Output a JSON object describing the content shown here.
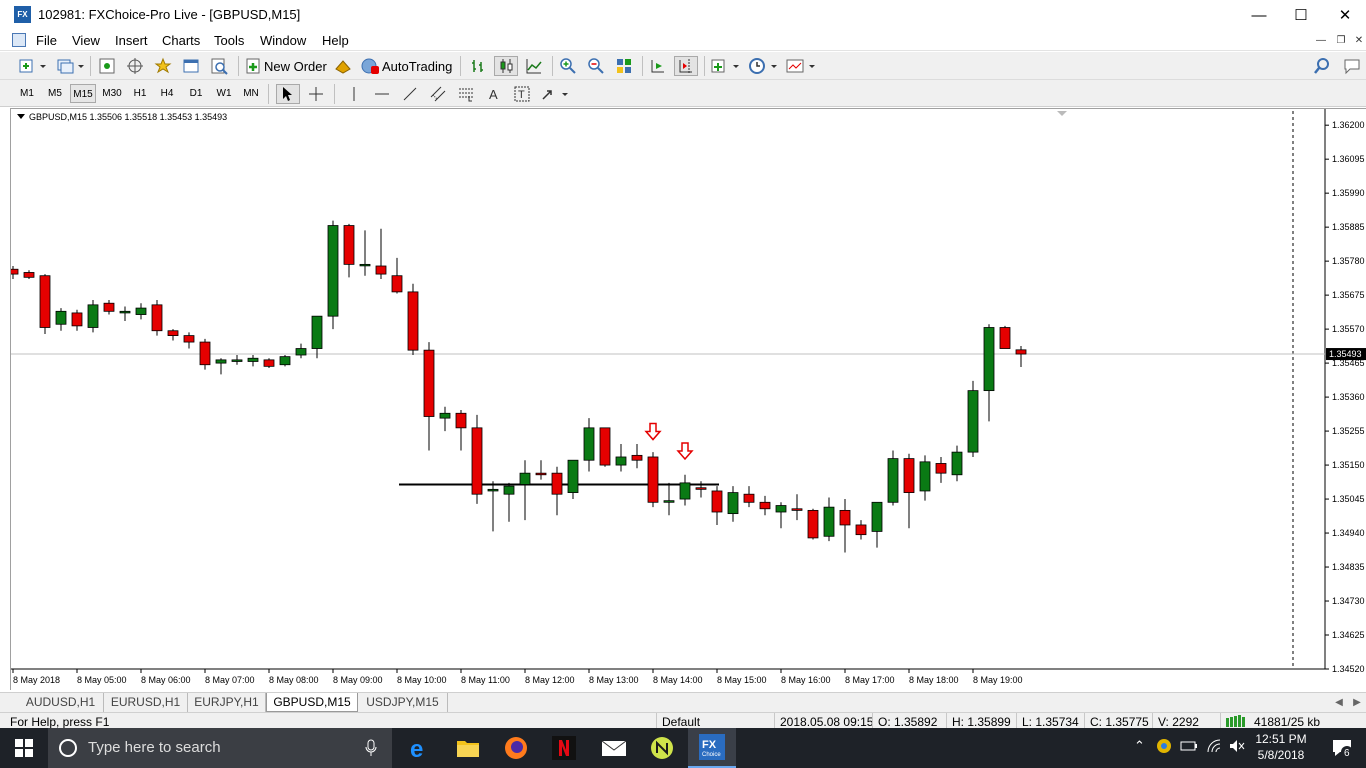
{
  "window": {
    "title": "102981: FXChoice-Pro Live - [GBPUSD,M15]",
    "app_icon_text": "FX"
  },
  "menu": [
    "File",
    "View",
    "Insert",
    "Charts",
    "Tools",
    "Window",
    "Help"
  ],
  "toolbar": {
    "new_order": "New Order",
    "autotrading": "AutoTrading"
  },
  "timeframes": [
    "M1",
    "M5",
    "M15",
    "M30",
    "H1",
    "H4",
    "D1",
    "W1",
    "MN"
  ],
  "active_timeframe": "M15",
  "chart_header": "GBPUSD,M15  1.35506 1.35518 1.35453 1.35493",
  "current_price_label": "1.35493",
  "chart_data": {
    "type": "candlestick",
    "symbol": "GBPUSD",
    "timeframe": "M15",
    "ylim": [
      1.3452,
      1.3625
    ],
    "y_ticks": [
      "1.36200",
      "1.36095",
      "1.35990",
      "1.35885",
      "1.35780",
      "1.35675",
      "1.35570",
      "1.35465",
      "1.35360",
      "1.35255",
      "1.35150",
      "1.35045",
      "1.34940",
      "1.34835",
      "1.34730",
      "1.34625",
      "1.34520"
    ],
    "x_ticks": [
      "8 May 2018",
      "8 May 05:00",
      "8 May 06:00",
      "8 May 07:00",
      "8 May 08:00",
      "8 May 09:00",
      "8 May 10:00",
      "8 May 11:00",
      "8 May 12:00",
      "8 May 13:00",
      "8 May 14:00",
      "8 May 15:00",
      "8 May 16:00",
      "8 May 17:00",
      "8 May 18:00",
      "8 May 19:00"
    ],
    "candles": [
      [
        1.35755,
        1.35765,
        1.35725,
        1.3574
      ],
      [
        1.35745,
        1.35752,
        1.35725,
        1.3573
      ],
      [
        1.35735,
        1.3574,
        1.35555,
        1.35575
      ],
      [
        1.35585,
        1.35635,
        1.35565,
        1.35625
      ],
      [
        1.3562,
        1.3563,
        1.35565,
        1.3558
      ],
      [
        1.35575,
        1.3566,
        1.3556,
        1.35645
      ],
      [
        1.3565,
        1.3566,
        1.35615,
        1.35625
      ],
      [
        1.3562,
        1.3564,
        1.35595,
        1.35625
      ],
      [
        1.35615,
        1.3565,
        1.356,
        1.35635
      ],
      [
        1.35645,
        1.3566,
        1.3555,
        1.35565
      ],
      [
        1.35565,
        1.3557,
        1.35535,
        1.3555
      ],
      [
        1.3555,
        1.3556,
        1.3551,
        1.3553
      ],
      [
        1.3553,
        1.3554,
        1.35445,
        1.3546
      ],
      [
        1.35465,
        1.3548,
        1.3543,
        1.35475
      ],
      [
        1.3547,
        1.3549,
        1.3546,
        1.35475
      ],
      [
        1.3547,
        1.3549,
        1.35455,
        1.3548
      ],
      [
        1.35475,
        1.3548,
        1.3545,
        1.35455
      ],
      [
        1.3546,
        1.3549,
        1.35455,
        1.35485
      ],
      [
        1.3549,
        1.35525,
        1.3548,
        1.3551
      ],
      [
        1.3551,
        1.35575,
        1.3548,
        1.3561
      ],
      [
        1.3561,
        1.35905,
        1.3557,
        1.3589
      ],
      [
        1.3589,
        1.35895,
        1.3573,
        1.3577
      ],
      [
        1.3577,
        1.35875,
        1.35735,
        1.3577
      ],
      [
        1.35765,
        1.3588,
        1.35725,
        1.3574
      ],
      [
        1.35735,
        1.3579,
        1.3568,
        1.35685
      ],
      [
        1.35685,
        1.3571,
        1.3549,
        1.35505
      ],
      [
        1.35505,
        1.3553,
        1.35195,
        1.353
      ],
      [
        1.35295,
        1.3533,
        1.35255,
        1.3531
      ],
      [
        1.3531,
        1.3532,
        1.35195,
        1.35265
      ],
      [
        1.35265,
        1.35305,
        1.3503,
        1.3506
      ],
      [
        1.3507,
        1.351,
        1.34945,
        1.35075
      ],
      [
        1.3506,
        1.35095,
        1.34975,
        1.35085
      ],
      [
        1.3509,
        1.35165,
        1.3498,
        1.35125
      ],
      [
        1.35125,
        1.35165,
        1.35105,
        1.3512
      ],
      [
        1.35125,
        1.35145,
        1.34995,
        1.3506
      ],
      [
        1.35065,
        1.35145,
        1.35045,
        1.35165
      ],
      [
        1.35165,
        1.35295,
        1.3513,
        1.35265
      ],
      [
        1.35265,
        1.35265,
        1.35145,
        1.3515
      ],
      [
        1.3515,
        1.35215,
        1.3513,
        1.35175
      ],
      [
        1.3518,
        1.35215,
        1.3514,
        1.35165
      ],
      [
        1.35175,
        1.3519,
        1.3502,
        1.35035
      ],
      [
        1.35035,
        1.35095,
        1.34995,
        1.3504
      ],
      [
        1.35045,
        1.3512,
        1.35025,
        1.35095
      ],
      [
        1.3508,
        1.351,
        1.3505,
        1.35075
      ],
      [
        1.3507,
        1.35085,
        1.34965,
        1.35005
      ],
      [
        1.35,
        1.35085,
        1.34975,
        1.35065
      ],
      [
        1.3506,
        1.35085,
        1.3502,
        1.35035
      ],
      [
        1.35035,
        1.35055,
        1.34995,
        1.35015
      ],
      [
        1.35005,
        1.35035,
        1.34955,
        1.35025
      ],
      [
        1.35015,
        1.3506,
        1.3498,
        1.3501
      ],
      [
        1.3501,
        1.35015,
        1.3492,
        1.34925
      ],
      [
        1.3493,
        1.3505,
        1.34915,
        1.3502
      ],
      [
        1.3501,
        1.35045,
        1.3488,
        1.34965
      ],
      [
        1.34965,
        1.3498,
        1.3492,
        1.34935
      ],
      [
        1.34945,
        1.3503,
        1.34895,
        1.35035
      ],
      [
        1.35035,
        1.35195,
        1.35025,
        1.3517
      ],
      [
        1.3517,
        1.35185,
        1.34955,
        1.35065
      ],
      [
        1.3507,
        1.3518,
        1.3504,
        1.3516
      ],
      [
        1.35155,
        1.35175,
        1.35095,
        1.35125
      ],
      [
        1.3512,
        1.3521,
        1.351,
        1.3519
      ],
      [
        1.3519,
        1.3541,
        1.35175,
        1.3538
      ],
      [
        1.3538,
        1.35585,
        1.35285,
        1.35575
      ],
      [
        1.35575,
        1.3558,
        1.3551,
        1.3551
      ],
      [
        1.35506,
        1.35518,
        1.35453,
        1.35493
      ]
    ],
    "horizontal_line": 1.3509,
    "arrows": [
      1.35235,
      1.35175
    ]
  },
  "colors": {
    "bull": "#0a7a14",
    "bear": "#e50000"
  },
  "chart_tabs": [
    "AUDUSD,H1",
    "EURUSD,H1",
    "EURJPY,H1",
    "GBPUSD,M15",
    "USDJPY,M15"
  ],
  "active_chart_tab": "GBPUSD,M15",
  "status": {
    "help": "For Help, press F1",
    "profile": "Default",
    "datetime": "2018.05.08 09:15",
    "open": "O: 1.35892",
    "high": "H: 1.35899",
    "low": "L: 1.35734",
    "close": "C: 1.35775",
    "volume": "V: 2292",
    "traffic": "41881/25 kb"
  },
  "taskbar": {
    "search_placeholder": "Type here to search",
    "time": "12:51 PM",
    "date": "5/8/2018",
    "notification_count": "6"
  }
}
